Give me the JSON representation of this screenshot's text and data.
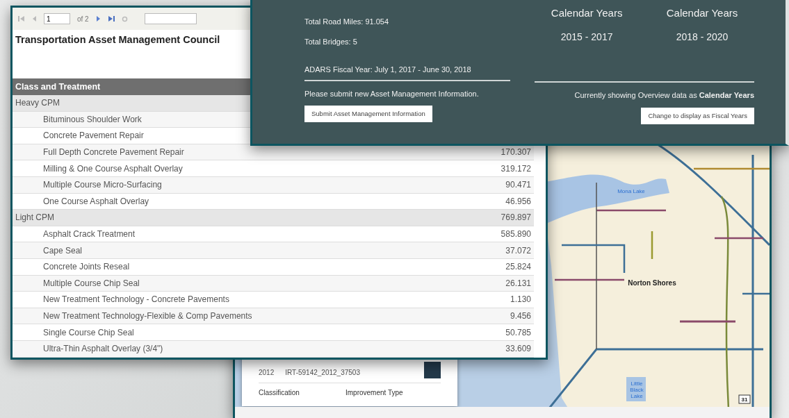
{
  "report": {
    "toolbar": {
      "page_value": "1",
      "page_count": "of 2"
    },
    "title": "Transportation Asset Management Council",
    "table": {
      "column_1": "Class and Treatment",
      "rows": [
        {
          "kind": "group",
          "label": "Heavy CPM"
        },
        {
          "kind": "item",
          "label": "Bituminous Shoulder Work"
        },
        {
          "kind": "item",
          "label": "Concrete Pavement Repair"
        },
        {
          "kind": "item",
          "label": "Full Depth Concrete Pavement Repair",
          "value": "170.307"
        },
        {
          "kind": "item",
          "label": "Milling & One Course Asphalt Overlay",
          "value": "319.172"
        },
        {
          "kind": "item",
          "label": "Multiple Course Micro-Surfacing",
          "value": "90.471"
        },
        {
          "kind": "item",
          "label": "One Course Asphalt Overlay",
          "value": "46.956"
        },
        {
          "kind": "group",
          "label": "Light CPM",
          "value": "769.897"
        },
        {
          "kind": "item",
          "label": "Asphalt Crack Treatment",
          "value": "585.890"
        },
        {
          "kind": "item",
          "label": "Cape Seal",
          "value": "37.072"
        },
        {
          "kind": "item",
          "label": "Concrete Joints Reseal",
          "value": "25.824"
        },
        {
          "kind": "item",
          "label": "Multiple Course Chip Seal",
          "value": "26.131"
        },
        {
          "kind": "item",
          "label": "New Treatment Technology - Concrete Pavements",
          "value": "1.130"
        },
        {
          "kind": "item",
          "label": "New Treatment Technology-Flexible & Comp Pavements",
          "value": "9.456"
        },
        {
          "kind": "item",
          "label": "Single Course Chip Seal",
          "value": "50.785"
        },
        {
          "kind": "item",
          "label": "Ultra-Thin Asphalt Overlay (3/4\")",
          "value": "33.609"
        }
      ]
    }
  },
  "overview": {
    "stats": [
      "Total Road Miles: 91.054",
      "Total Bridges: 5"
    ],
    "fiscal_year": "ADARS Fiscal Year: July 1, 2017 - June 30, 2018",
    "periods": [
      {
        "label": "Calendar Years",
        "range": "2015 - 2017"
      },
      {
        "label": "Calendar Years",
        "range": "2018 - 2020"
      }
    ],
    "submit_prompt": "Please submit new Asset Management Information.",
    "submit_button": "Submit Asset Management Information",
    "display_note": "Currently showing Overview data as **Calendar Years**",
    "toggle_button": "Change to display as Fiscal Years"
  },
  "map": {
    "labels": [
      {
        "kind": "lake",
        "text": "Mona Lake"
      },
      {
        "kind": "place",
        "text": "Norton Shores"
      },
      {
        "kind": "lake",
        "text": "Little Black Lake"
      },
      {
        "kind": "route",
        "text": "31"
      }
    ],
    "popup": {
      "year": "2012",
      "project_number": "IRT-59142_2012_37503",
      "fields": [
        "Classification",
        "Improvement Type"
      ]
    }
  }
}
